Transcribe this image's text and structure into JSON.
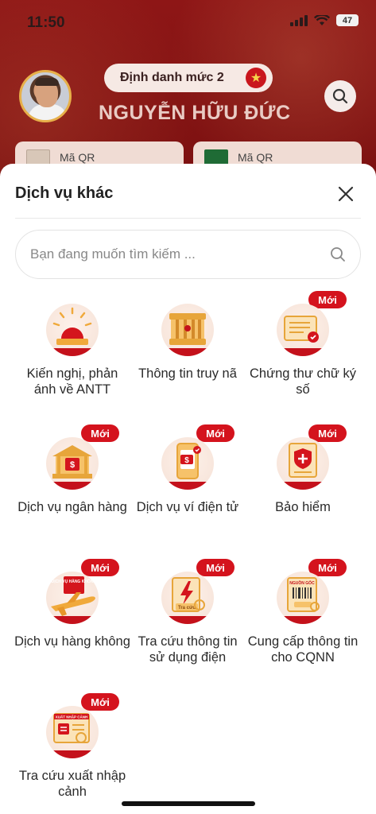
{
  "status_bar": {
    "time": "11:50",
    "battery": "47"
  },
  "profile": {
    "id_level": "Định danh mức 2",
    "name": "NGUYỄN HỮU ĐỨC",
    "qr_cards": [
      "Mã QR",
      "Mã QR"
    ]
  },
  "sheet": {
    "title": "Dịch vụ khác",
    "search_placeholder": "Bạn đang muốn tìm kiếm ...",
    "new_badge": "Mới",
    "services": [
      {
        "label": "Kiến nghị, phản ánh về ANTT",
        "icon": "siren-icon",
        "is_new": false
      },
      {
        "label": "Thông tin truy nã",
        "icon": "prison-bars-icon",
        "is_new": false
      },
      {
        "label": "Chứng thư chữ ký số",
        "icon": "certificate-icon",
        "is_new": true
      },
      {
        "label": "Dịch vụ ngân hàng",
        "icon": "bank-icon",
        "is_new": true
      },
      {
        "label": "Dịch vụ ví điện tử",
        "icon": "e-wallet-icon",
        "is_new": true
      },
      {
        "label": "Bảo hiểm",
        "icon": "insurance-icon",
        "is_new": true
      },
      {
        "label": "Dịch vụ hàng không",
        "icon": "airplane-icon",
        "is_new": true,
        "icon_text": "DỊCH VỤ HÀNG KHÔNG"
      },
      {
        "label": "Tra cứu thông tin sử dụng điện",
        "icon": "electricity-icon",
        "is_new": true,
        "icon_text": "Tra cứu"
      },
      {
        "label": "Cung cấp thông tin cho CQNN",
        "icon": "barcode-document-icon",
        "is_new": true,
        "icon_text": "NGUỒN GỐC"
      },
      {
        "label": "Tra cứu xuất nhập cảnh",
        "icon": "passport-icon",
        "is_new": true,
        "icon_text": "XUẤT NHẬP CẢNH"
      }
    ]
  },
  "colors": {
    "brand_red": "#c4111b",
    "badge_red": "#d4131d",
    "gold": "#e7a53a"
  }
}
